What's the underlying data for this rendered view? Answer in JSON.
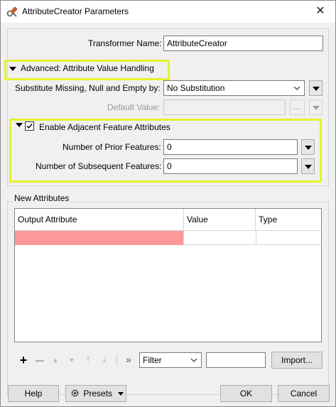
{
  "window": {
    "title": "AttributeCreator Parameters",
    "close": "✕"
  },
  "transformer": {
    "label": "Transformer Name:",
    "value": "AttributeCreator"
  },
  "advanced": {
    "section_label": "Advanced: Attribute Value Handling",
    "substitute_label": "Substitute Missing, Null and Empty by:",
    "substitute_value": "No Substitution",
    "default_label": "Default Value:",
    "default_value": "",
    "ellipsis": "...",
    "adjacent": {
      "label": "Enable Adjacent Feature Attributes",
      "checked": true,
      "prior_label": "Number of Prior Features:",
      "prior_value": "0",
      "subsequent_label": "Number of Subsequent Features:",
      "subsequent_value": "0"
    }
  },
  "new_attributes": {
    "group_label": "New Attributes",
    "columns": [
      "Output Attribute",
      "Value",
      "Type"
    ],
    "rows": [
      {
        "output_attribute": "",
        "value": "",
        "type": ""
      }
    ],
    "toolbar": {
      "add": "+",
      "remove": "—",
      "move_up": "▲",
      "move_down": "▼",
      "move_top": "⤒",
      "move_bottom": "⤓",
      "more": "»",
      "filter_value": "Filter",
      "filter_text": "",
      "import_label": "Import..."
    }
  },
  "footer": {
    "help": "Help",
    "presets": "Presets",
    "ok": "OK",
    "cancel": "Cancel"
  },
  "colors": {
    "highlight": "#e5f22a",
    "selected_cell": "#fb9999",
    "dialog_bg": "#f0f0f0"
  }
}
